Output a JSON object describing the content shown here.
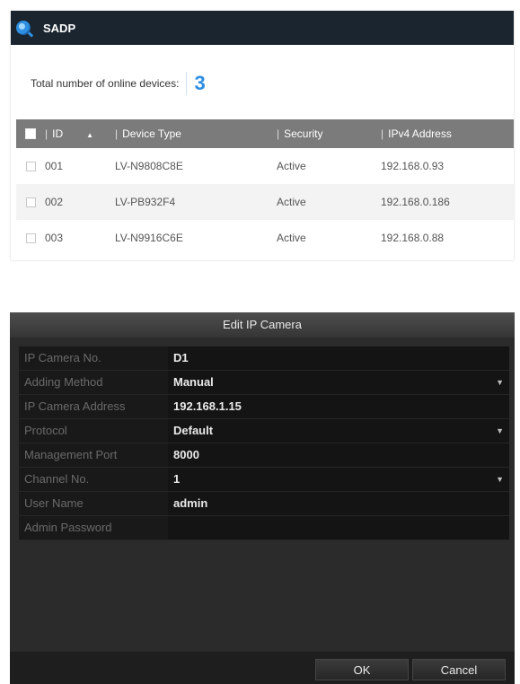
{
  "sadp": {
    "title": "SADP",
    "online_label": "Total number of online devices:",
    "online_count": "3",
    "columns": {
      "id": "ID",
      "device_type": "Device Type",
      "security": "Security",
      "ipv4": "IPv4 Address"
    },
    "devices": [
      {
        "id": "001",
        "device_type": "LV-N9808C8E",
        "security": "Active",
        "ipv4": "192.168.0.93"
      },
      {
        "id": "002",
        "device_type": "LV-PB932F4",
        "security": "Active",
        "ipv4": "192.168.0.186"
      },
      {
        "id": "003",
        "device_type": "LV-N9916C6E",
        "security": "Active",
        "ipv4": "192.168.0.88"
      }
    ]
  },
  "dialog": {
    "title": "Edit IP Camera",
    "fields": {
      "camera_no": {
        "label": "IP Camera No.",
        "value": "D1"
      },
      "adding_method": {
        "label": "Adding Method",
        "value": "Manual"
      },
      "camera_address": {
        "label": "IP Camera Address",
        "value": "192.168.1.15"
      },
      "protocol": {
        "label": "Protocol",
        "value": "Default"
      },
      "management_port": {
        "label": "Management Port",
        "value": "8000"
      },
      "channel_no": {
        "label": "Channel No.",
        "value": "1"
      },
      "user_name": {
        "label": "User Name",
        "value": "admin"
      },
      "admin_password": {
        "label": "Admin Password",
        "value": ""
      }
    },
    "ok_label": "OK",
    "cancel_label": "Cancel"
  },
  "icons": {
    "app_logo": "sadp-logo-icon",
    "dropdown": "chevron-down-icon",
    "sort": "sort-ascending-icon"
  },
  "colors": {
    "accent": "#2b8de3",
    "title_bar": "#1b2530",
    "table_header": "#7b7b7b",
    "dialog_bg": "#2b2b2b"
  }
}
